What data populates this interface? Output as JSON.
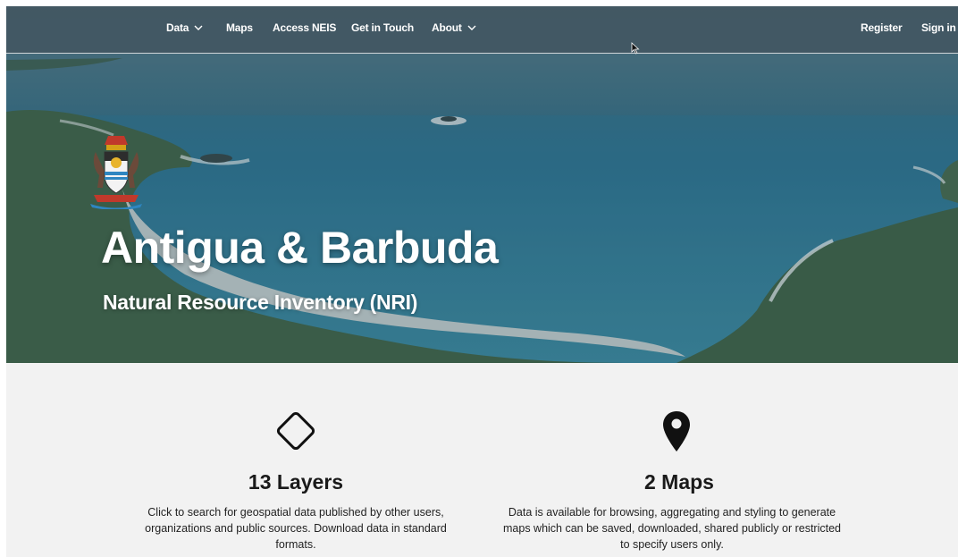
{
  "nav": {
    "items": [
      {
        "label": "Data",
        "has_dropdown": true
      },
      {
        "label": "Maps",
        "has_dropdown": false
      },
      {
        "label": "Access NEIS",
        "has_dropdown": false
      },
      {
        "label": "Get in Touch",
        "has_dropdown": false
      },
      {
        "label": "About",
        "has_dropdown": true
      }
    ],
    "right": {
      "register": "Register",
      "sign_in": "Sign in"
    }
  },
  "hero": {
    "title": "Antigua & Barbuda",
    "subtitle": "Natural Resource Inventory (NRI)",
    "crest_icon": "coat-of-arms-icon"
  },
  "stats": [
    {
      "icon": "diamond-icon",
      "title": "13 Layers",
      "description": "Click to search for geospatial data published by other users, organizations and public sources. Download data in standard formats."
    },
    {
      "icon": "map-pin-icon",
      "title": "2 Maps",
      "description": "Data is available for browsing, aggregating and styling to generate maps which can be saved, downloaded, shared publicly or restricted to specify users only."
    }
  ],
  "colors": {
    "nav_bg": "#46555f",
    "stats_bg": "#f2f2f2",
    "hero_water": "#2b7a95"
  }
}
